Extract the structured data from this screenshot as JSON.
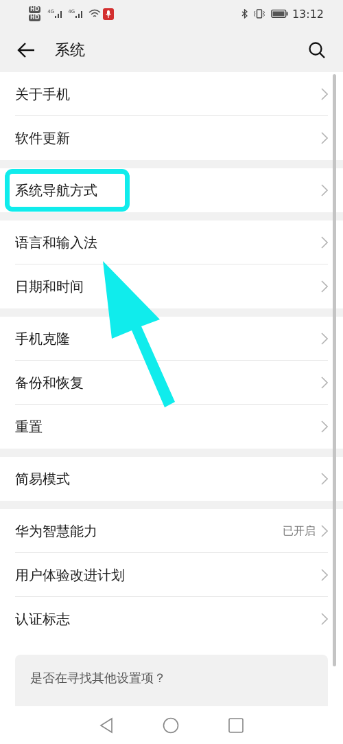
{
  "status_bar": {
    "hd_badges": [
      "HD",
      "HD"
    ],
    "networks": [
      "4G",
      "4G"
    ],
    "time": "13:12"
  },
  "header": {
    "title": "系统"
  },
  "groups": [
    [
      {
        "label": "关于手机",
        "highlighted": false
      },
      {
        "label": "软件更新",
        "highlighted": false
      }
    ],
    [
      {
        "label": "系统导航方式",
        "highlighted": true
      }
    ],
    [
      {
        "label": "语言和输入法",
        "highlighted": false
      },
      {
        "label": "日期和时间",
        "highlighted": false
      }
    ],
    [
      {
        "label": "手机克隆",
        "highlighted": false
      },
      {
        "label": "备份和恢复",
        "highlighted": false
      },
      {
        "label": "重置",
        "highlighted": false
      }
    ],
    [
      {
        "label": "简易模式",
        "highlighted": false
      }
    ],
    [
      {
        "label": "华为智慧能力",
        "value": "已开启",
        "highlighted": false
      },
      {
        "label": "用户体验改进计划",
        "highlighted": false
      },
      {
        "label": "认证标志",
        "highlighted": false
      }
    ]
  ],
  "suggestion_card": {
    "text": "是否在寻找其他设置项？"
  }
}
